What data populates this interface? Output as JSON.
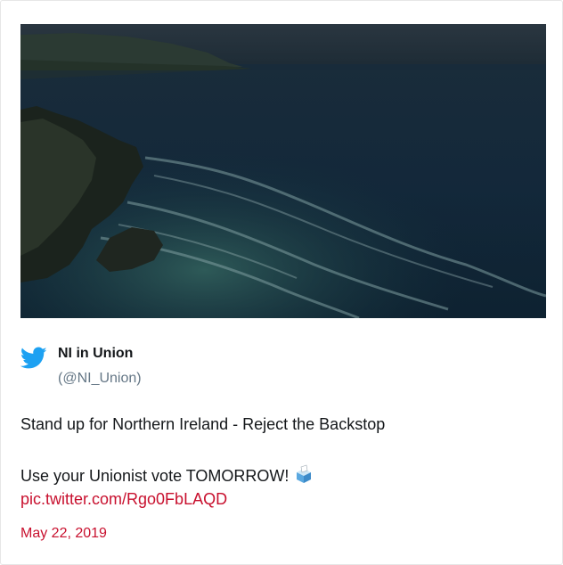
{
  "author": {
    "name": "NI in Union",
    "handle": "(@NI_Union)"
  },
  "tweet": {
    "line1": "Stand up for Northern Ireland - Reject the Backstop",
    "line2": "Use your Unionist vote TOMORROW!",
    "emoji_icon": "ballot-box-icon",
    "link": "pic.twitter.com/Rgo0FbLAQD",
    "date": "May 22, 2019"
  },
  "media": {
    "description_icon": "coastal-cliff-photo"
  },
  "colors": {
    "twitter_blue": "#1da1f2",
    "link_red": "#c8102e",
    "text": "#14171a",
    "muted": "#657786"
  }
}
